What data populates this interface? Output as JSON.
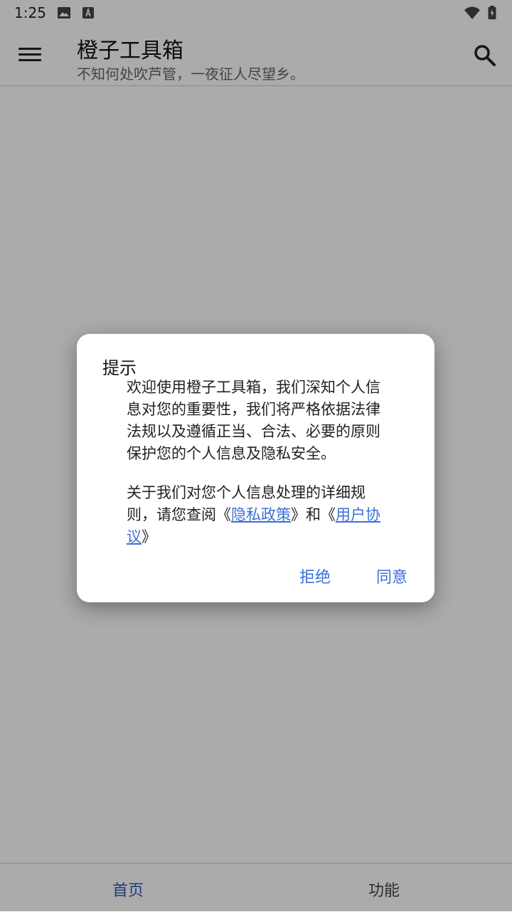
{
  "status_bar": {
    "time": "1:25"
  },
  "app_bar": {
    "title": "橙子工具箱",
    "subtitle": "不知何处吹芦管，一夜征人尽望乡。"
  },
  "dialog": {
    "title": "提示",
    "paragraph1": "欢迎使用橙子工具箱，我们深知个人信息对您的重要性，我们将严格依据法律法规以及遵循正当、合法、必要的原则保护您的个人信息及隐私安全。",
    "paragraph2_prefix": "关于我们对您个人信息处理的详细规则，请您查阅《",
    "privacy_link": "隐私政策",
    "paragraph2_middle": "》和《",
    "agreement_link": "用户协议",
    "paragraph2_suffix": "》",
    "reject_label": "拒绝",
    "agree_label": "同意"
  },
  "bottom_nav": {
    "items": [
      {
        "label": "首页",
        "active": true
      },
      {
        "label": "功能",
        "active": false
      }
    ]
  },
  "colors": {
    "accent": "#3d6fd6",
    "nav_active": "#2d58b8"
  }
}
